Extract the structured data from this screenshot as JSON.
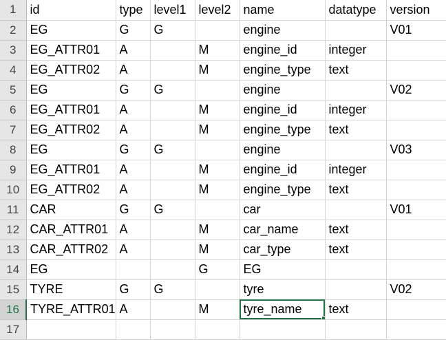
{
  "sheet": {
    "active_row": 16,
    "active_col": 4,
    "rows": [
      {
        "num": "1",
        "cells": [
          "id",
          "type",
          "level1",
          "level2",
          "name",
          "datatype",
          "version"
        ]
      },
      {
        "num": "2",
        "cells": [
          "EG",
          "G",
          "G",
          "",
          "engine",
          "",
          "V01"
        ]
      },
      {
        "num": "3",
        "cells": [
          "EG_ATTR01",
          "A",
          "",
          "M",
          "engine_id",
          "integer",
          ""
        ]
      },
      {
        "num": "4",
        "cells": [
          "EG_ATTR02",
          "A",
          "",
          "M",
          "engine_type",
          "text",
          ""
        ]
      },
      {
        "num": "5",
        "cells": [
          "EG",
          "G",
          "G",
          "",
          "engine",
          "",
          "V02"
        ]
      },
      {
        "num": "6",
        "cells": [
          "EG_ATTR01",
          "A",
          "",
          "M",
          "engine_id",
          "integer",
          ""
        ]
      },
      {
        "num": "7",
        "cells": [
          "EG_ATTR02",
          "A",
          "",
          "M",
          "engine_type",
          "text",
          ""
        ]
      },
      {
        "num": "8",
        "cells": [
          "EG",
          "G",
          "G",
          "",
          "engine",
          "",
          "V03"
        ]
      },
      {
        "num": "9",
        "cells": [
          "EG_ATTR01",
          "A",
          "",
          "M",
          "engine_id",
          "integer",
          ""
        ]
      },
      {
        "num": "10",
        "cells": [
          "EG_ATTR02",
          "A",
          "",
          "M",
          "engine_type",
          "text",
          ""
        ]
      },
      {
        "num": "11",
        "cells": [
          "CAR",
          "G",
          "G",
          "",
          "car",
          "",
          "V01"
        ]
      },
      {
        "num": "12",
        "cells": [
          "CAR_ATTR01",
          "A",
          "",
          "M",
          "car_name",
          "text",
          ""
        ]
      },
      {
        "num": "13",
        "cells": [
          "CAR_ATTR02",
          "A",
          "",
          "M",
          "car_type",
          "text",
          ""
        ]
      },
      {
        "num": "14",
        "cells": [
          "EG",
          "",
          "",
          "G",
          "EG",
          "",
          ""
        ]
      },
      {
        "num": "15",
        "cells": [
          "TYRE",
          "G",
          "G",
          "",
          "tyre",
          "",
          "V02"
        ]
      },
      {
        "num": "16",
        "cells": [
          "TYRE_ATTR01",
          "A",
          "",
          "M",
          "tyre_name",
          "text",
          ""
        ]
      },
      {
        "num": "17",
        "cells": [
          "",
          "",
          "",
          "",
          "",
          "",
          ""
        ]
      }
    ]
  }
}
